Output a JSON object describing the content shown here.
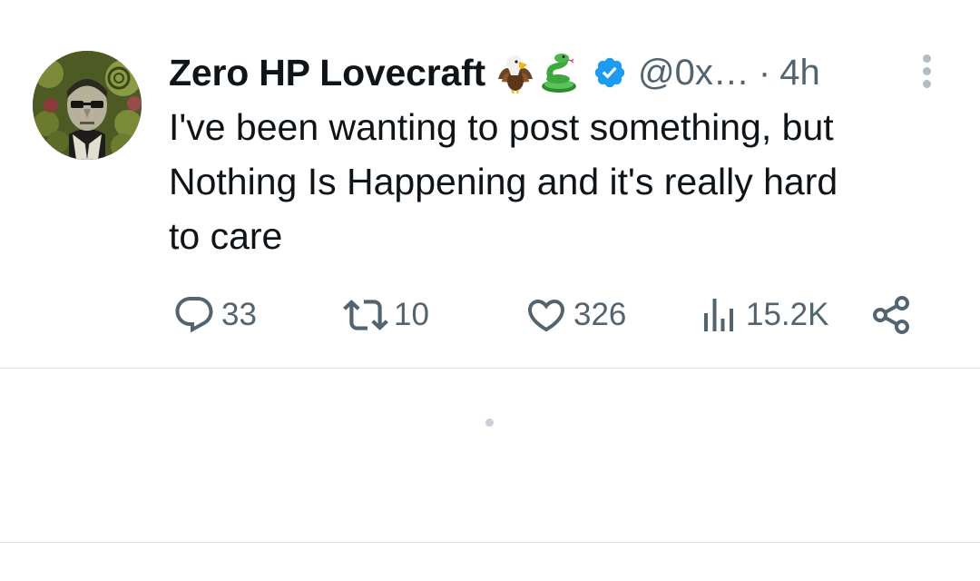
{
  "tweet": {
    "author": {
      "display_name": "Zero HP Lovecraft",
      "emojis": [
        "eagle-emoji",
        "snake-emoji"
      ],
      "verified": true,
      "handle": "@0x…",
      "separator": "·",
      "timestamp": "4h"
    },
    "text": "I've been wanting to post something, but\nNothing Is Happening and it's really hard\nto care",
    "actions": {
      "replies": "33",
      "retweets": "10",
      "likes": "326",
      "views": "15.2K"
    }
  },
  "icons": {
    "avatar": "avatar-image",
    "verified": "verified-badge-icon",
    "more": "more-vertical-icon",
    "reply": "reply-icon",
    "retweet": "retweet-icon",
    "like": "heart-icon",
    "views": "views-chart-icon",
    "share": "share-icon"
  },
  "colors": {
    "text_primary": "#0f1419",
    "text_secondary": "#536471",
    "verified_blue": "#1d9bf0",
    "divider": "#dfe4e8"
  }
}
